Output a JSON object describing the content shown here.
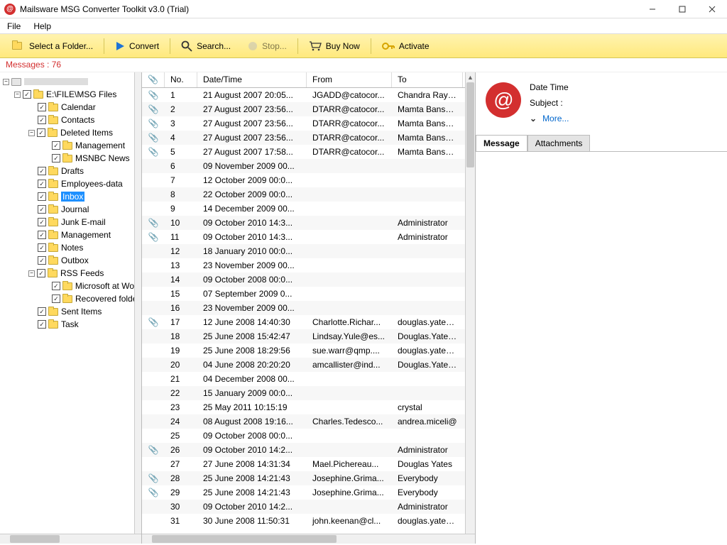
{
  "window": {
    "title": "Mailsware MSG Converter Toolkit v3.0 (Trial)"
  },
  "menu": {
    "file": "File",
    "help": "Help"
  },
  "toolbar": {
    "select_folder": "Select a Folder...",
    "convert": "Convert",
    "search": "Search...",
    "stop": "Stop...",
    "buy": "Buy Now",
    "activate": "Activate"
  },
  "counter": "Messages : 76",
  "tree": {
    "root_label": "",
    "drive": "E:\\FILE\\MSG Files",
    "items": [
      "Calendar",
      "Contacts",
      "Deleted Items",
      "Management",
      "MSNBC News",
      "Drafts",
      "Employees-data",
      "Inbox",
      "Journal",
      "Junk E-mail",
      "Management",
      "Notes",
      "Outbox",
      "RSS Feeds",
      "Microsoft at Work",
      "Recovered folde",
      "Sent Items",
      "Task"
    ]
  },
  "list": {
    "headers": {
      "no": "No.",
      "dt": "Date/Time",
      "from": "From",
      "to": "To"
    },
    "rows": [
      {
        "clip": true,
        "no": "1",
        "dt": "21 August 2007 20:05...",
        "from": "JGADD@catocor...",
        "to": "Chandra Ray (E"
      },
      {
        "clip": true,
        "no": "2",
        "dt": "27 August 2007 23:56...",
        "from": "DTARR@catocor...",
        "to": "Mamta Bansal ("
      },
      {
        "clip": true,
        "no": "3",
        "dt": "27 August 2007 23:56...",
        "from": "DTARR@catocor...",
        "to": "Mamta Bansal ("
      },
      {
        "clip": true,
        "no": "4",
        "dt": "27 August 2007 23:56...",
        "from": "DTARR@catocor...",
        "to": "Mamta Bansal ("
      },
      {
        "clip": true,
        "no": "5",
        "dt": "27 August 2007 17:58...",
        "from": "DTARR@catocor...",
        "to": "Mamta Bansal ("
      },
      {
        "clip": false,
        "no": "6",
        "dt": "09 November 2009 00...",
        "from": "",
        "to": ""
      },
      {
        "clip": false,
        "no": "7",
        "dt": "12 October 2009 00:0...",
        "from": "",
        "to": ""
      },
      {
        "clip": false,
        "no": "8",
        "dt": "22 October 2009 00:0...",
        "from": "",
        "to": ""
      },
      {
        "clip": false,
        "no": "9",
        "dt": "14 December 2009 00...",
        "from": "",
        "to": ""
      },
      {
        "clip": true,
        "no": "10",
        "dt": "09 October 2010 14:3...",
        "from": "",
        "to": "Administrator"
      },
      {
        "clip": true,
        "no": "11",
        "dt": "09 October 2010 14:3...",
        "from": "",
        "to": "Administrator"
      },
      {
        "clip": false,
        "no": "12",
        "dt": "18 January 2010 00:0...",
        "from": "",
        "to": ""
      },
      {
        "clip": false,
        "no": "13",
        "dt": "23 November 2009 00...",
        "from": "",
        "to": ""
      },
      {
        "clip": false,
        "no": "14",
        "dt": "09 October 2008 00:0...",
        "from": "",
        "to": ""
      },
      {
        "clip": false,
        "no": "15",
        "dt": "07 September 2009 0...",
        "from": "",
        "to": ""
      },
      {
        "clip": false,
        "no": "16",
        "dt": "23 November 2009 00...",
        "from": "",
        "to": ""
      },
      {
        "clip": true,
        "no": "17",
        "dt": "12 June 2008 14:40:30",
        "from": "Charlotte.Richar...",
        "to": "douglas.yates@"
      },
      {
        "clip": false,
        "no": "18",
        "dt": "25 June 2008 15:42:47",
        "from": "Lindsay.Yule@es...",
        "to": "Douglas.Yates@"
      },
      {
        "clip": false,
        "no": "19",
        "dt": "25 June 2008 18:29:56",
        "from": "sue.warr@qmp....",
        "to": "douglas.yates@"
      },
      {
        "clip": false,
        "no": "20",
        "dt": "04 June 2008 20:20:20",
        "from": "amcallister@ind...",
        "to": "Douglas.Yates@"
      },
      {
        "clip": false,
        "no": "21",
        "dt": "04 December 2008 00...",
        "from": "",
        "to": ""
      },
      {
        "clip": false,
        "no": "22",
        "dt": "15 January 2009 00:0...",
        "from": "",
        "to": ""
      },
      {
        "clip": false,
        "no": "23",
        "dt": "25 May 2011 10:15:19",
        "from": "",
        "to": "crystal"
      },
      {
        "clip": false,
        "no": "24",
        "dt": "08 August 2008 19:16...",
        "from": "Charles.Tedesco...",
        "to": "andrea.miceli@"
      },
      {
        "clip": false,
        "no": "25",
        "dt": "09 October 2008 00:0...",
        "from": "",
        "to": ""
      },
      {
        "clip": true,
        "no": "26",
        "dt": "09 October 2010 14:2...",
        "from": "",
        "to": "Administrator"
      },
      {
        "clip": false,
        "no": "27",
        "dt": "27 June 2008 14:31:34",
        "from": "Mael.Pichereau...",
        "to": "Douglas Yates"
      },
      {
        "clip": true,
        "no": "28",
        "dt": "25 June 2008 14:21:43",
        "from": "Josephine.Grima...",
        "to": "Everybody"
      },
      {
        "clip": true,
        "no": "29",
        "dt": "25 June 2008 14:21:43",
        "from": "Josephine.Grima...",
        "to": "Everybody"
      },
      {
        "clip": false,
        "no": "30",
        "dt": "09 October 2010 14:2...",
        "from": "",
        "to": "Administrator"
      },
      {
        "clip": false,
        "no": "31",
        "dt": "30 June 2008 11:50:31",
        "from": "john.keenan@cl...",
        "to": "douglas.yates@"
      }
    ]
  },
  "preview": {
    "date_time_label": "Date Time",
    "subject_label": "Subject :",
    "more": "More...",
    "tabs": {
      "message": "Message",
      "attachments": "Attachments"
    }
  }
}
